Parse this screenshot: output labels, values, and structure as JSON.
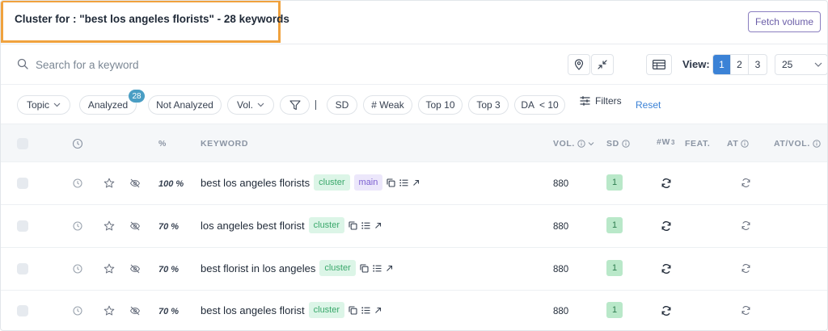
{
  "header": {
    "title": "Cluster for : \"best los angeles florists\" - 28 keywords",
    "fetch_button": "Fetch volume"
  },
  "search": {
    "placeholder": "Search for a keyword",
    "view_label": "View:",
    "view_options": [
      "1",
      "2",
      "3"
    ],
    "view_active": "1",
    "per_page": "25"
  },
  "filters": {
    "topic": "Topic",
    "analyzed": "Analyzed",
    "analyzed_count": "28",
    "not_analyzed": "Not Analyzed",
    "vol": "Vol.",
    "sd": "SD",
    "weak": "# Weak",
    "top10": "Top 10",
    "top3": "Top 3",
    "da": "DA  < 10",
    "filters": "Filters",
    "reset": "Reset"
  },
  "table": {
    "headers": {
      "pct": "%",
      "keyword": "KEYWORD",
      "vol": "VOL.",
      "sd": "SD",
      "w": "#W",
      "w_sup": "3",
      "feat": "FEAT.",
      "at": "AT",
      "at_vol": "AT/VOL."
    },
    "rows": [
      {
        "pct": "100 %",
        "keyword": "best los angeles florists",
        "tags": [
          "cluster",
          "main"
        ],
        "vol": "880",
        "sd": "1"
      },
      {
        "pct": "70 %",
        "keyword": "los angeles best florist",
        "tags": [
          "cluster"
        ],
        "vol": "880",
        "sd": "1"
      },
      {
        "pct": "70 %",
        "keyword": "best florist in los angeles",
        "tags": [
          "cluster"
        ],
        "vol": "880",
        "sd": "1"
      },
      {
        "pct": "70 %",
        "keyword": "best los angeles florist",
        "tags": [
          "cluster"
        ],
        "vol": "880",
        "sd": "1"
      }
    ]
  },
  "colors": {
    "accent": "#3b82d6",
    "highlight_border": "#f0a23e",
    "cluster_tag_bg": "#dcf5e7",
    "main_tag_bg": "#ece7fb",
    "sd_badge_bg": "#b9e8c9"
  }
}
